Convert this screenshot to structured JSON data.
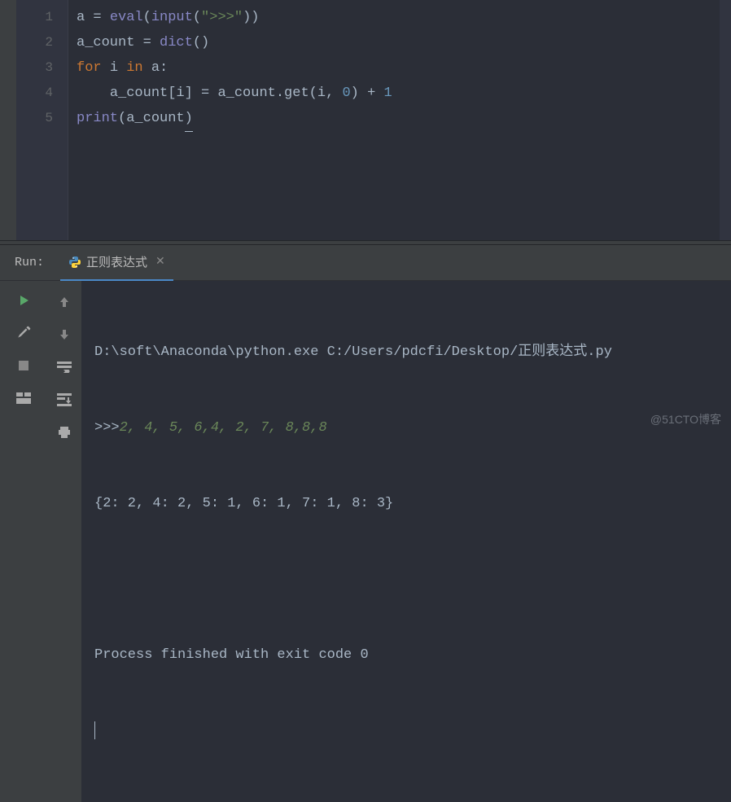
{
  "editor": {
    "line_numbers": [
      "1",
      "2",
      "3",
      "4",
      "5"
    ],
    "code": {
      "l1": {
        "a": "a ",
        "eq": "= ",
        "eval": "eval",
        "p1": "(",
        "input": "input",
        "p2": "(",
        "str": "\">>>\"",
        "p3": "))"
      },
      "l2": {
        "a": "a_count ",
        "eq": "= ",
        "dict": "dict",
        "p1": "()"
      },
      "l3": {
        "for": "for ",
        "i": "i ",
        "in": "in ",
        "a": "a",
        "colon": ":"
      },
      "l4": {
        "indent": "    ",
        "ac": "a_count[i] ",
        "eq": "= ",
        "ac2": "a_count.get(i",
        "comma": ", ",
        "zero": "0",
        "p1": ") + ",
        "one": "1"
      },
      "l5": {
        "print": "print",
        "p1": "(",
        "ac": "a_count",
        "p2": ")"
      }
    }
  },
  "run": {
    "label": "Run:",
    "tab_name": "正则表达式",
    "close_glyph": "✕",
    "console": {
      "line1": "D:\\soft\\Anaconda\\python.exe C:/Users/pdcfi/Desktop/正则表达式.py",
      "line2_prompt": ">>>",
      "line2_input": "2, 4, 5, 6,4, 2, 7, 8,8,8",
      "line3": "{2: 2, 4: 2, 5: 1, 6: 1, 7: 1, 8: 3}",
      "line4": "",
      "line5": "Process finished with exit code 0"
    }
  },
  "watermark": "@51CTO博客"
}
